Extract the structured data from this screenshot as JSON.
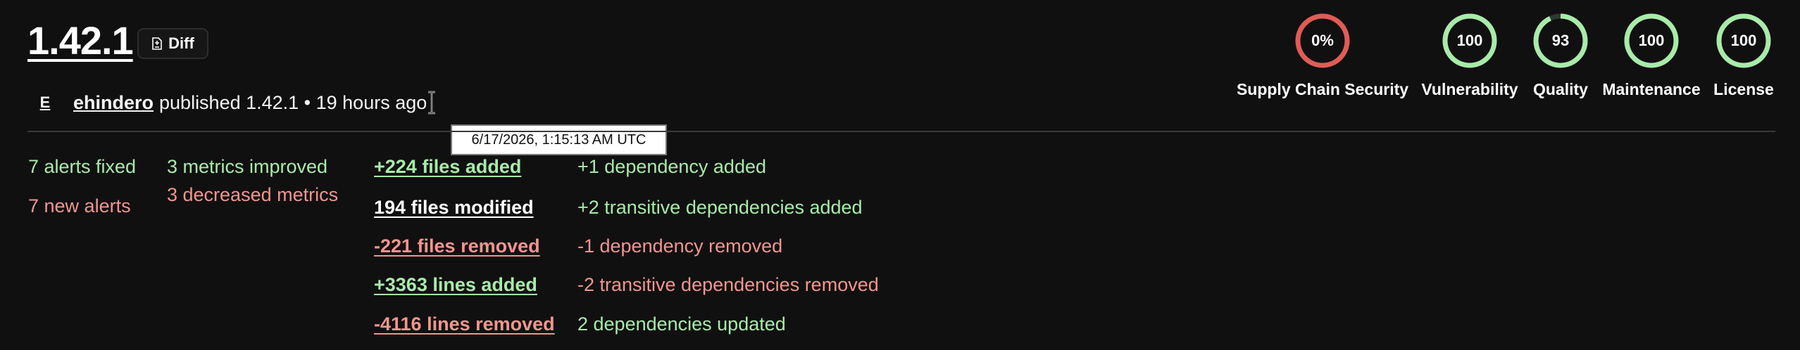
{
  "header": {
    "version": "1.42.1",
    "diff_label": "Diff",
    "avatar_letter": "E",
    "author": "ehindero",
    "published_text": "published 1.42.1 • 19 hours ago",
    "tooltip": "6/17/2026, 1:15:13 AM UTC"
  },
  "scores": [
    {
      "value": "0%",
      "percent": 0,
      "label": "Supply Chain Security",
      "color": "#e05c55"
    },
    {
      "value": "100",
      "percent": 100,
      "label": "Vulnerability",
      "color": "#a8eba9"
    },
    {
      "value": "93",
      "percent": 93,
      "label": "Quality",
      "color": "#a8eba9"
    },
    {
      "value": "100",
      "percent": 100,
      "label": "Maintenance",
      "color": "#a8eba9"
    },
    {
      "value": "100",
      "percent": 100,
      "label": "License",
      "color": "#a8eba9"
    }
  ],
  "alerts": {
    "fixed": "7 alerts fixed",
    "new": "7 new alerts"
  },
  "metrics": {
    "improved": "3 metrics improved",
    "decreased": "3 decreased metrics"
  },
  "files": {
    "added": "+224 files added",
    "modified": "194 files modified",
    "removed": "-221 files removed",
    "lines_added": "+3363 lines added",
    "lines_removed": "-4116 lines removed"
  },
  "dependencies": {
    "added": "+1 dependency added",
    "transitive_added": "+2 transitive dependencies added",
    "removed": "-1 dependency removed",
    "transitive_removed": "-2 transitive dependencies removed",
    "updated": "2 dependencies updated"
  },
  "colors": {
    "positive": "#a8eba9",
    "negative": "#f0968e",
    "background": "#111011"
  }
}
